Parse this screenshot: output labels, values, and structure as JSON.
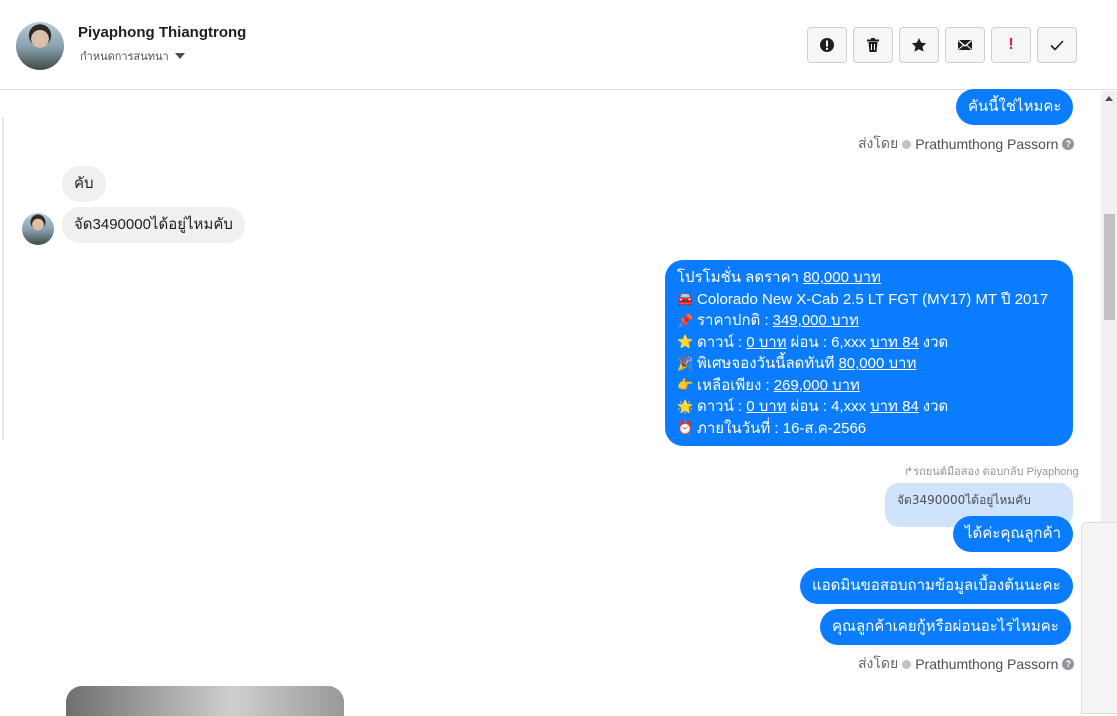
{
  "header": {
    "name": "Piyaphong Thiangtrong",
    "assign_label": "กำหนดการสนทนา",
    "toolbar": [
      "spam-icon",
      "trash-icon",
      "star-icon",
      "mail-icon",
      "important-icon",
      "check-icon"
    ],
    "important_mark": "!"
  },
  "messages": {
    "m1": "คันนี้ใช่ไหมคะ",
    "sentby1_prefix": "ส่งโดย",
    "sentby1_name": "Prathumthong Passorn",
    "in1": "คับ",
    "in2": "จัด3490000ได้อยู่ไหมคับ",
    "promo": {
      "l1_a": "โปรโมชั่น ลดราคา ",
      "l1_b": "80,000 บาท",
      "l2": "Colorado New X-Cab 2.5 LT FGT (MY17) MT ปี 2017",
      "l3_a": "ราคาปกติ : ",
      "l3_b": "349,000 บาท",
      "l4_a": "ดาวน์ : ",
      "l4_b": "0 บาท",
      "l4_c": " ผ่อน : 6,xxx ",
      "l4_d": "บาท 84",
      "l4_e": " งวด",
      "l5_a": "พิเศษจองวันนี้ลดทันที ",
      "l5_b": "80,000 บาท",
      "l6_a": "เหลือเพียง : ",
      "l6_b": "269,000 บาท",
      "l7_a": "ดาวน์ : ",
      "l7_b": "0 บาท",
      "l7_c": " ผ่อน : 4,xxx ",
      "l7_d": "บาท 84",
      "l7_e": " งวด",
      "l8": "ภายในวันที่ : 16-ส.ค-2566"
    },
    "reply_note": "รถยนต์มือสอง ตอบกลับ Piyaphong",
    "quoted": "จัด3490000ได้อยู่ไหมคับ",
    "m2": "ได้ค่ะคุณลูกค้า",
    "m3": "แอดมินขอสอบถามข้อมูลเบื้องต้นนะคะ",
    "m4": "คุณลูกค้าเคยกู้หรือผ่อนอะไรไหมคะ",
    "sentby2_prefix": "ส่งโดย",
    "sentby2_name": "Prathumthong Passorn",
    "help_mark": "?"
  },
  "colors": {
    "outgoing": "#0a7cff",
    "incoming": "#f1f0f0",
    "quoted": "#cfe3fb"
  }
}
